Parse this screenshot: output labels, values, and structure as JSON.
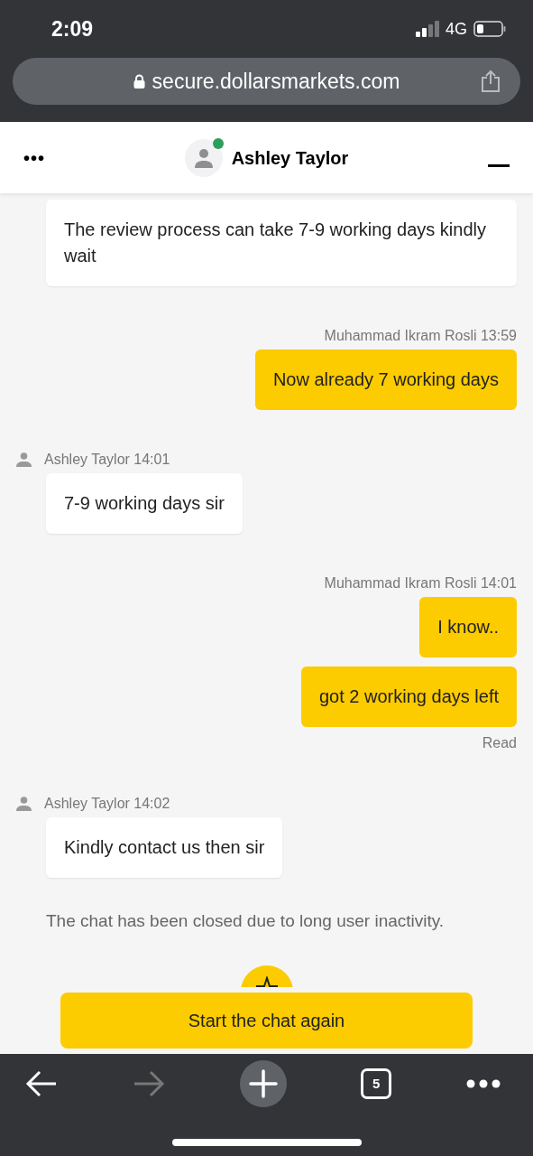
{
  "status_bar": {
    "time": "2:09",
    "network": "4G"
  },
  "browser": {
    "url": "secure.dollarsmarkets.com",
    "tab_count": "5"
  },
  "header": {
    "menu": "•••",
    "name": "Ashley Taylor",
    "online": true
  },
  "messages": [
    {
      "kind": "agent",
      "bubbles": [
        "The review process can take 7-9 working days kindly wait"
      ]
    },
    {
      "kind": "user",
      "meta": "Muhammad Ikram Rosli 13:59",
      "bubbles": [
        "Now already 7 working days"
      ]
    },
    {
      "kind": "agent",
      "meta": "Ashley Taylor 14:01",
      "bubbles": [
        "7-9 working days sir"
      ]
    },
    {
      "kind": "user",
      "meta": "Muhammad Ikram Rosli 14:01",
      "bubbles": [
        "I know..",
        "got 2 working days left"
      ],
      "receipt": "Read"
    },
    {
      "kind": "agent",
      "meta": "Ashley Taylor 14:02",
      "bubbles": [
        "Kindly contact us then sir"
      ]
    }
  ],
  "system_note": "The chat has been closed due to long user inactivity.",
  "restart_button": "Start the chat again"
}
